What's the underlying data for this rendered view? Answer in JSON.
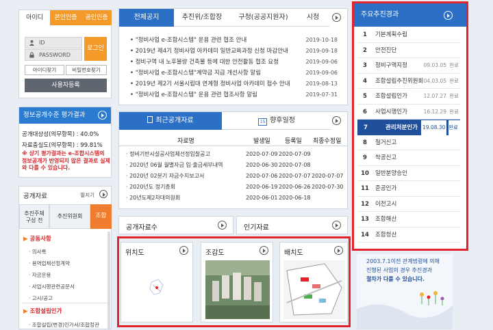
{
  "login": {
    "tabs": [
      "아이디",
      "본인인증",
      "공인인증"
    ],
    "id_placeholder": "ID",
    "pw_placeholder": "PASSWORD",
    "login_button": "로그인",
    "find_id": "아이디찾기",
    "find_pw": "비밀번호찾기",
    "register": "사용자등록"
  },
  "eval": {
    "title": "정보공개수준 평가결과",
    "line1": "공개대상성(의무항목) : 40.0%",
    "line2": "자료충실도(의무항목) : 99.81%",
    "notice": "※ 상기 평가결과는 e-조합시스템의 정보공개가 반영되지 않은 결과로 실제와 다를 수 있습니다."
  },
  "side": {
    "title": "공개자료",
    "expand": "펼치기",
    "tabs": [
      "추진주체\n구성 전",
      "추진위원회",
      "조합"
    ],
    "sec1": "공동사항",
    "sec1_items": [
      "의사록",
      "용역업체선정계약",
      "자금운용",
      "사업시행관련공문서",
      "고시/공고"
    ],
    "sec2": "조합설립인가",
    "sec2_items": [
      "조합설립(변경)인가서/조합정관"
    ]
  },
  "notice": {
    "tabs": [
      "전체공지",
      "추진위/조합장",
      "구청(공공지원자)",
      "시청"
    ],
    "items": [
      {
        "t": "\"정비사업 e-조합시스템\" 운용 관련 협조 안내",
        "d": "2019-10-18"
      },
      {
        "t": "2019년 제4기 정비사업 아카데미 일반교육과정 신청 마감안내",
        "d": "2019-09-18"
      },
      {
        "t": "정비구역 내 노후불량 건축물 등에 대한 안전활동 협조 요청",
        "d": "2019-09-06"
      },
      {
        "t": "\"정비사업 e-조합시스템\"계약금 지급 개선사항 알림",
        "d": "2019-09-06"
      },
      {
        "t": "2019년 제2기 서울시립대 연계형 정비사업 아카데미 접수 안내",
        "d": "2019-08-13"
      },
      {
        "t": "\"정비사업 e-조합시스템\" 운용 관련 협조사항 알림",
        "d": "2019-07-31"
      }
    ]
  },
  "recent": {
    "tab1": "최근공개자료",
    "tab2": "향후일정",
    "cal_day": "15",
    "headers": [
      "자료명",
      "발생일",
      "등록일",
      "최종수정일"
    ],
    "rows": [
      {
        "n": "정비기반시설공사업체선정입찰공고",
        "a": "2020-07-09",
        "b": "2020-07-09",
        "c": ""
      },
      {
        "n": "2020년 06월 월별자금 입·출금세부내역",
        "a": "2020-06-30",
        "b": "2020-07-08",
        "c": ""
      },
      {
        "n": "2020년 02분기 자금수지보고서",
        "a": "2020-07-06",
        "b": "2020-07-07",
        "c": "2020-07-07"
      },
      {
        "n": "2020년도 정기총회",
        "a": "2020-06-19",
        "b": "2020-06-26",
        "c": "2020-07-30"
      },
      {
        "n": "20년도제2차대의원회",
        "a": "2020-06-01",
        "b": "2020-06-18",
        "c": ""
      }
    ]
  },
  "public_count": "공개자료수",
  "popular": "인기자료",
  "maps": [
    {
      "t": "위치도"
    },
    {
      "t": "조감도"
    },
    {
      "t": "배치도"
    }
  ],
  "progress": {
    "title": "주요추진경과",
    "items": [
      {
        "n": "1",
        "t": "기본계획수립",
        "d": "",
        "s": ""
      },
      {
        "n": "2",
        "t": "안전진단",
        "d": "",
        "s": ""
      },
      {
        "n": "3",
        "t": "정비구역지정",
        "d": "09.03.05",
        "s": "완료"
      },
      {
        "n": "4",
        "t": "조합설립추진위원회",
        "d": "04.03.05",
        "s": "완료"
      },
      {
        "n": "5",
        "t": "조합설립인가",
        "d": "12.07.27",
        "s": "완료"
      },
      {
        "n": "6",
        "t": "사업시행인가",
        "d": "16.12.29",
        "s": "완료"
      },
      {
        "n": "7",
        "t": "관리처분인가",
        "d": "19.08.30",
        "s": "완료"
      },
      {
        "n": "8",
        "t": "철거신고",
        "d": "",
        "s": ""
      },
      {
        "n": "9",
        "t": "착공신고",
        "d": "",
        "s": ""
      },
      {
        "n": "10",
        "t": "일반분양승인",
        "d": "",
        "s": ""
      },
      {
        "n": "11",
        "t": "준공인가",
        "d": "",
        "s": ""
      },
      {
        "n": "12",
        "t": "이전고시",
        "d": "",
        "s": ""
      },
      {
        "n": "13",
        "t": "조합해산",
        "d": "",
        "s": ""
      },
      {
        "n": "14",
        "t": "조합청산",
        "d": "",
        "s": ""
      }
    ]
  },
  "footnote": {
    "l1": "2003.7.1이전 관계법령에 의해",
    "l2": "진행된 사업의 경우 추진경과",
    "l3": "절차가 다를 수 있습니다."
  },
  "colors": {
    "blue": "#2b6fc6",
    "orange": "#ef7d2d",
    "red": "#e2232b",
    "navy": "#1f4f9a"
  }
}
